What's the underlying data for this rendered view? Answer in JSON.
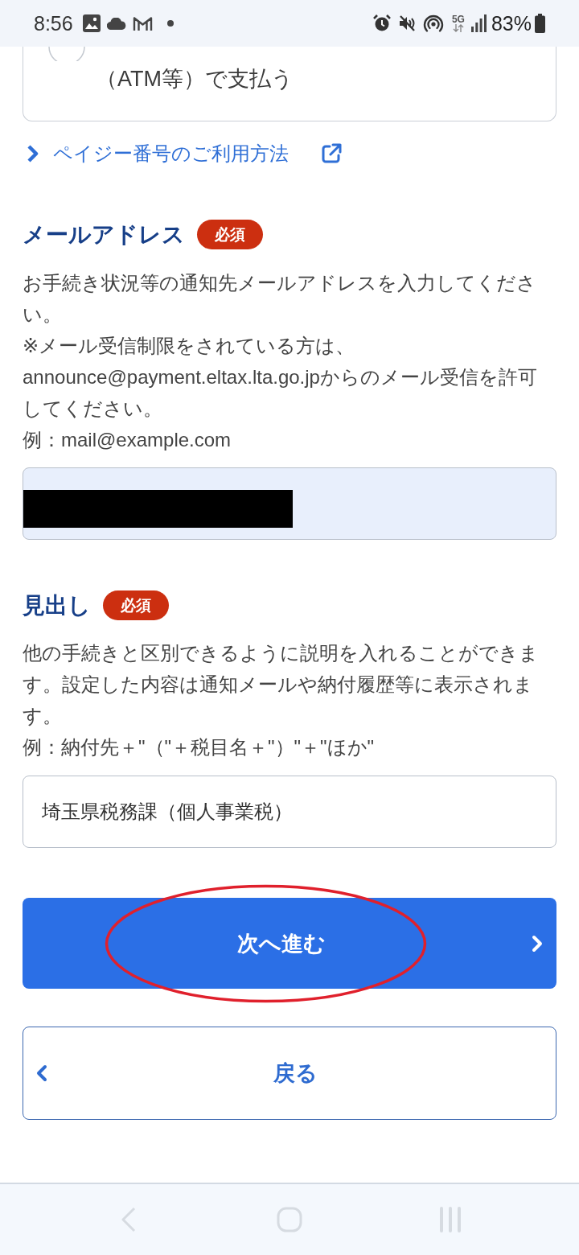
{
  "status_bar": {
    "time": "8:56",
    "network": "5G",
    "battery": "83%"
  },
  "payment_option": {
    "label": "（ATM等）で支払う",
    "selected": false
  },
  "help_link": {
    "label": "ペイジー番号のご利用方法"
  },
  "fields": [
    {
      "label": "メールアドレス",
      "badge": "必須",
      "description": [
        "お手続き状況等の通知先メールアドレスを入力してください。",
        "※メール受信制限をされている方は、",
        "announce@payment.eltax.lta.go.jpからのメール受信を許可してください。",
        "例：mail@example.com"
      ],
      "autofilled": true,
      "value_redacted": true
    },
    {
      "label": "見出し",
      "badge": "必須",
      "description": [
        "他の手続きと区別できるように説明を入れることができます。設定した内容は通知メールや納付履歴等に表示されます。",
        "例：納付先＋\"（\"＋税目名＋\"）\"＋\"ほか\""
      ],
      "autofilled": false,
      "value": "埼玉県税務課（個人事業税）"
    }
  ],
  "buttons": [
    {
      "kind": "primary",
      "label": "次へ進む",
      "circled": true
    },
    {
      "kind": "secondary",
      "label": "戻る",
      "circled": false
    }
  ]
}
